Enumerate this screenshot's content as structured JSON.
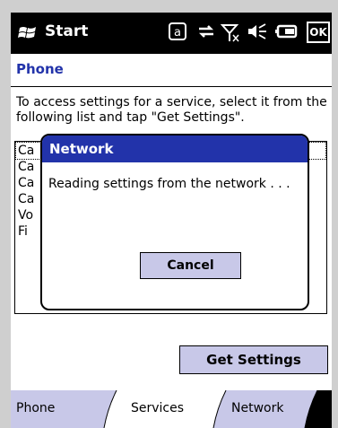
{
  "statusbar": {
    "start_label": "Start",
    "ok_label": "OK",
    "icons": [
      "windows-logo",
      "at-sign-icon",
      "connectivity-icon",
      "signal-off-icon",
      "speaker-icon",
      "battery-icon"
    ]
  },
  "header": {
    "title": "Phone"
  },
  "instructions": "To access settings for a service, select it from the following list and tap \"Get Settings\".",
  "list": {
    "items": [
      "Ca",
      "Ca",
      "Ca",
      "Ca",
      "Vo",
      "Fi"
    ]
  },
  "dialog": {
    "title": "Network",
    "message": "Reading settings from the network . . .",
    "cancel_label": "Cancel"
  },
  "buttons": {
    "get_settings": "Get Settings"
  },
  "tabs": [
    {
      "label": "Phone",
      "active": false
    },
    {
      "label": "Services",
      "active": true
    },
    {
      "label": "Network",
      "active": false
    }
  ],
  "colors": {
    "accent": "#2233aa",
    "button_bg": "#c8c8e8"
  }
}
